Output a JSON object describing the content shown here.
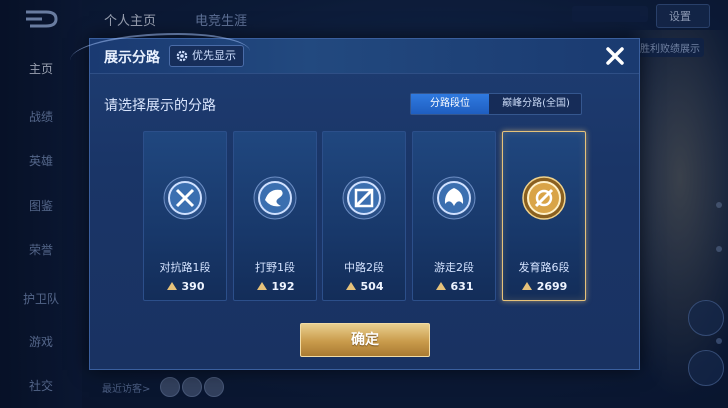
{
  "background": {
    "nav_items": [
      {
        "label": "主页",
        "active": true
      },
      {
        "label": "战绩",
        "active": false
      },
      {
        "label": "英雄",
        "active": false
      },
      {
        "label": "图鉴",
        "active": false
      },
      {
        "label": "荣誉",
        "active": false
      },
      {
        "label": "护卫队",
        "active": false
      },
      {
        "label": "游戏",
        "active": false
      },
      {
        "label": "社交",
        "active": false
      }
    ],
    "top_tabs": [
      "个人主页",
      "电竞生涯"
    ],
    "settings_label": "设置",
    "right_label": "胜利败绩展示",
    "recent_visitors_label": "最近访客>"
  },
  "modal": {
    "title": "展示分路",
    "priority_label": "优先显示",
    "prompt": "请选择展示的分路",
    "segments": [
      {
        "label": "分路段位",
        "active": true
      },
      {
        "label": "巅峰分路(全国)",
        "active": false
      }
    ],
    "cards": [
      {
        "name": "对抗路1段",
        "score": "390",
        "icon": "sword-badge-icon",
        "selected": false
      },
      {
        "name": "打野1段",
        "score": "192",
        "icon": "dragon-badge-icon",
        "selected": false
      },
      {
        "name": "中路2段",
        "score": "504",
        "icon": "staff-badge-icon",
        "selected": false
      },
      {
        "name": "游走2段",
        "score": "631",
        "icon": "wing-badge-icon",
        "selected": false
      },
      {
        "name": "发育路6段",
        "score": "2699",
        "icon": "bow-badge-icon",
        "selected": true
      }
    ],
    "confirm_label": "确定"
  },
  "colors": {
    "accent_gold": "#e6c27a",
    "tab_active": "#2f7ae0",
    "panel_bg": "#1a3567"
  }
}
